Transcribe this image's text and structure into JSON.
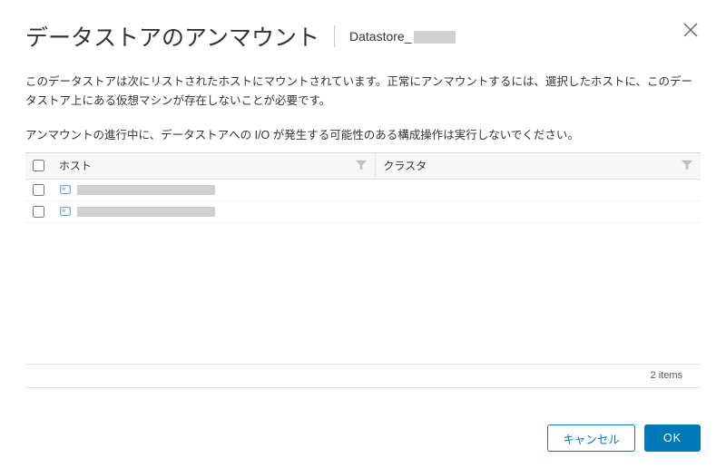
{
  "header": {
    "title": "データストアのアンマウント",
    "datastore_prefix": "Datastore_"
  },
  "description": {
    "line1": "このデータストアは次にリストされたホストにマウントされています。正常にアンマウントするには、選択したホストに、このデータストア上にある仮想マシンが存在しないことが必要です。",
    "line2": "アンマウントの進行中に、データストアへの I/O が発生する可能性のある構成操作は実行しないでください。"
  },
  "grid": {
    "columns": {
      "host": "ホスト",
      "cluster": "クラスタ"
    },
    "rows": [
      {
        "host_redacted": true
      },
      {
        "host_redacted": true
      }
    ],
    "footer_items": "2 items"
  },
  "buttons": {
    "cancel": "キャンセル",
    "ok": "OK"
  }
}
